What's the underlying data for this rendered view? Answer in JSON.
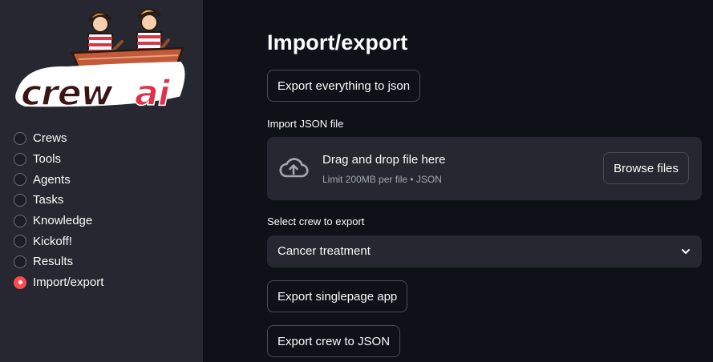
{
  "sidebar": {
    "logo": {
      "text": "crewai",
      "icon": "rowers-boat-logo"
    },
    "items": [
      {
        "label": "Crews",
        "selected": false
      },
      {
        "label": "Tools",
        "selected": false
      },
      {
        "label": "Agents",
        "selected": false
      },
      {
        "label": "Tasks",
        "selected": false
      },
      {
        "label": "Knowledge",
        "selected": false
      },
      {
        "label": "Kickoff!",
        "selected": false
      },
      {
        "label": "Results",
        "selected": false
      },
      {
        "label": "Import/export",
        "selected": true
      }
    ]
  },
  "main": {
    "title": "Import/export",
    "export_all_label": "Export everything to json",
    "import_label": "Import JSON file",
    "uploader": {
      "icon": "cloud-upload-icon",
      "title": "Drag and drop file here",
      "subtitle": "Limit 200MB per file • JSON",
      "browse_label": "Browse files"
    },
    "select_label": "Select crew to export",
    "select_value": "Cancer treatment",
    "export_spa_label": "Export singlepage app",
    "export_crew_label": "Export crew to JSON"
  },
  "colors": {
    "background": "#0e1117",
    "sidebar": "#262730",
    "accent": "#ff4b4b",
    "logo_red": "#e0304a",
    "logo_dark": "#3a1417"
  }
}
